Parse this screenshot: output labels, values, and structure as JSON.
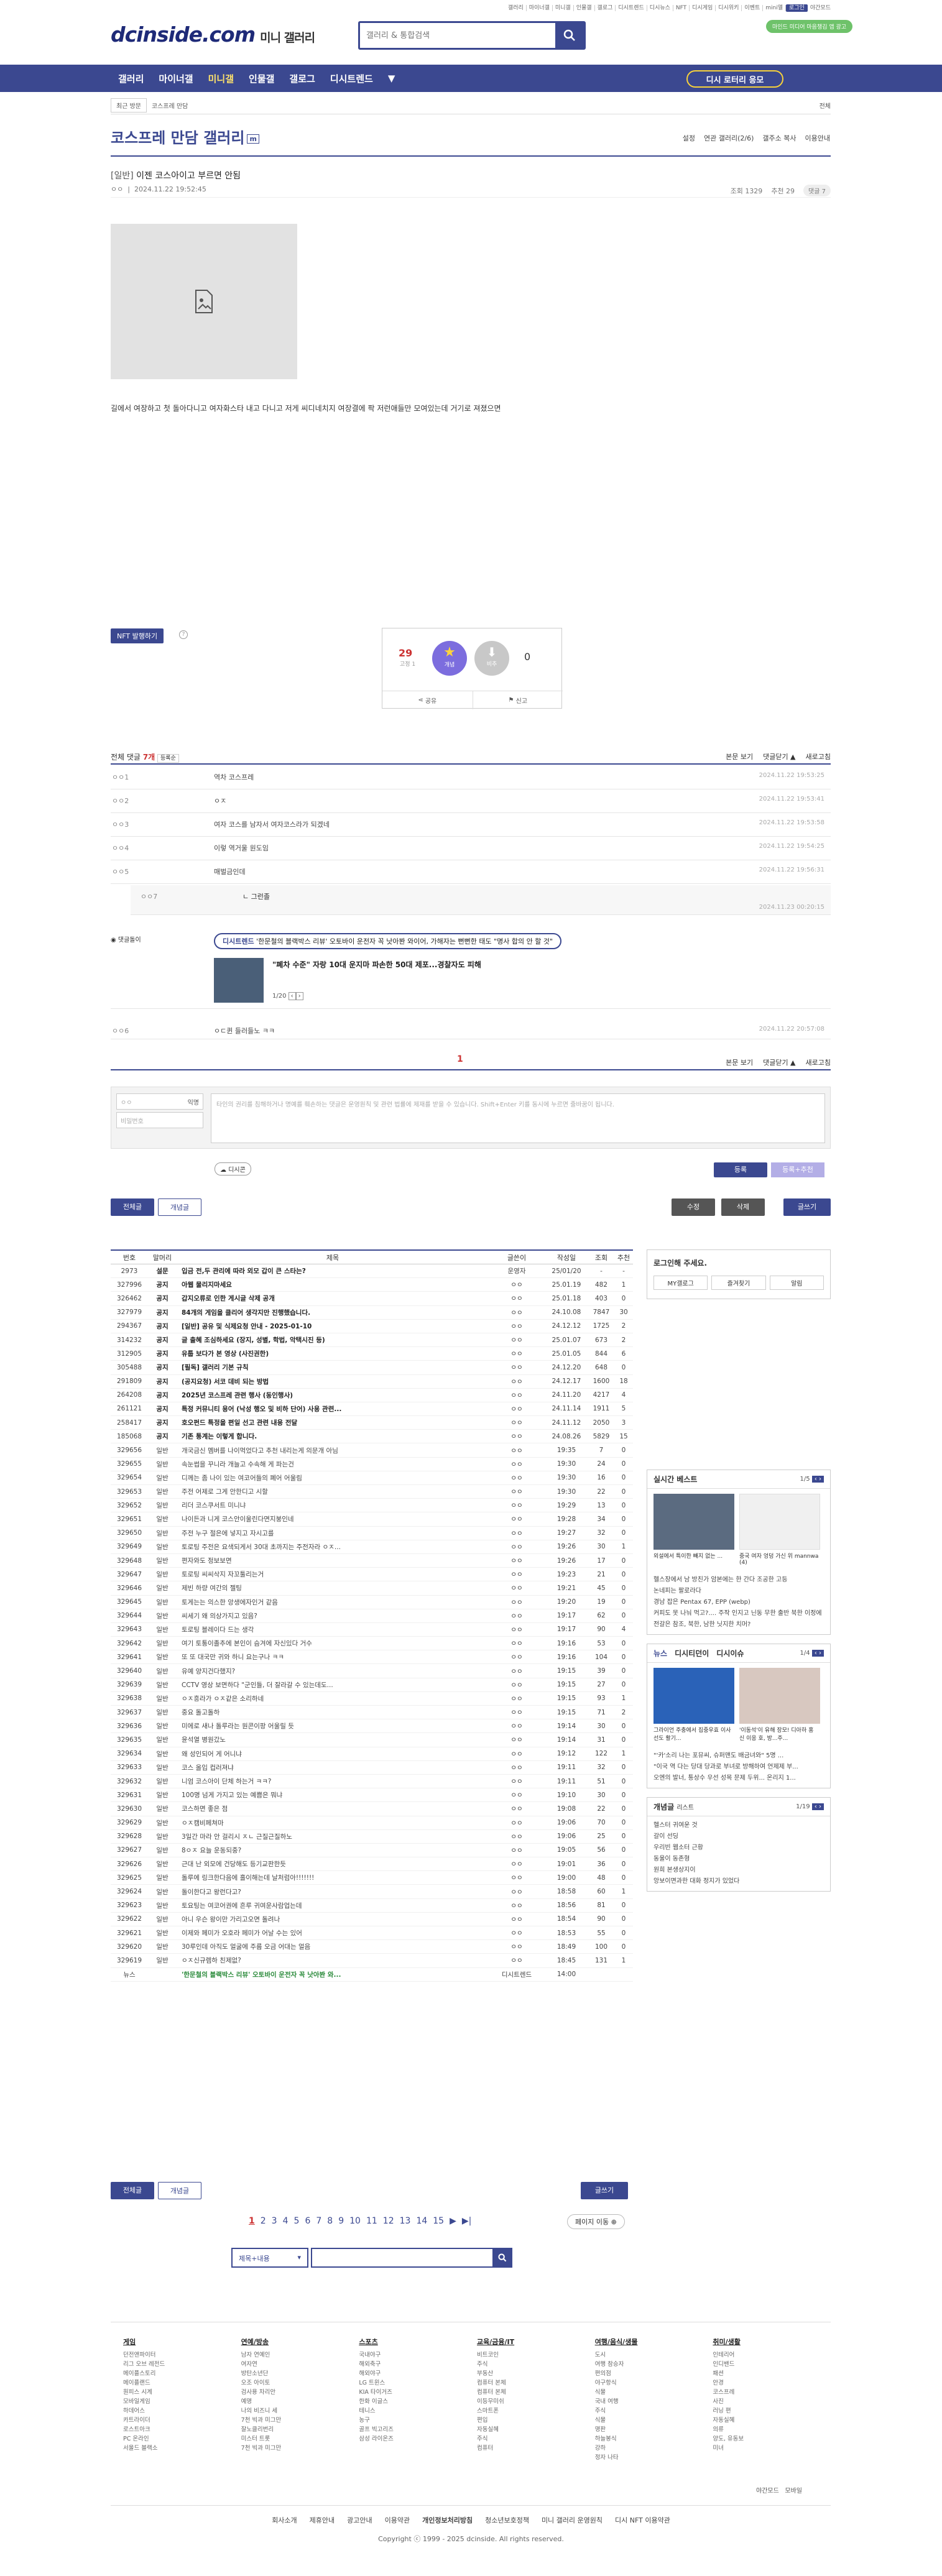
{
  "top_util": [
    "갤러리",
    "마이너갤",
    "미니갤",
    "인물갤",
    "갤로그",
    "디시트렌드",
    "디시뉴스",
    "NFT",
    "디시게임",
    "디시위키",
    "이벤트",
    "mini앨",
    "로그인",
    "야간모드"
  ],
  "logo": {
    "main": "dcinside.com",
    "sub": "미니 갤러리"
  },
  "search": {
    "placeholder": "갤러리 & 통합검색"
  },
  "promo": "마인드 미디어 마음챙김 앱 광고",
  "nav": {
    "items": [
      "갤러리",
      "마이너갤",
      "미니갤",
      "인물갤",
      "갤로그",
      "디시트렌드",
      "▼"
    ],
    "active_index": 2,
    "cta": "디시 로터리 응모"
  },
  "breadcrumb": {
    "scope": "최근 방문",
    "item": "코스프레 만담",
    "right": "전체"
  },
  "gallery": {
    "title": "코스프레 만담 갤러리",
    "badge": "m",
    "tabs": [
      "설정",
      "연관 갤러리(2/6)",
      "갤주소 복사",
      "이용안내"
    ]
  },
  "post": {
    "head": "[일반]",
    "title": "이젠 코스아이고 부르면 안됨",
    "author": "ㅇㅇ",
    "date": "2024.11.22 19:52:45",
    "views": "조회 1329",
    "recommend": "추천 29",
    "comment_btn": "댓글 7",
    "body": "길에서 여장하고 첫 돌아다니고 여자화스타 내고 다니고 저게 씨디네치지 여장결에 팍 저런애들만 모여있는데 거기로 져졌으면"
  },
  "nft_btn": "NFT 발행하기",
  "vote": {
    "up_count": "29",
    "up_sub": "고정 1",
    "up_label": "개념",
    "down_label": "비추",
    "down_count": "0",
    "share": "공유",
    "report": "신고"
  },
  "comments": {
    "label": "전체 댓글",
    "count": "7개",
    "sort": "등록순",
    "view_body": "본문 보기",
    "toggle": "댓글닫기 ▲",
    "refresh": "새로고침",
    "items": [
      {
        "nick": "ㅇㅇ1",
        "text": "역차 코스프레",
        "date": "2024.11.22 19:53:25"
      },
      {
        "nick": "ㅇㅇ2",
        "text": "ㅇㅈ",
        "date": "2024.11.22 19:53:41"
      },
      {
        "nick": "ㅇㅇ3",
        "text": "여자 코스를 남자서 여자코스라가 되겠네",
        "date": "2024.11.22 19:53:58"
      },
      {
        "nick": "ㅇㅇ4",
        "text": "이렇 역거울 원도임",
        "date": "2024.11.22 19:54:25"
      },
      {
        "nick": "ㅇㅇ5",
        "text": "매벌금인데",
        "date": "2024.11.22 19:56:31"
      }
    ],
    "reply": {
      "nick": "ㅇㅇ7",
      "text": "ㄴ 그런졸",
      "date": "2024.11.23 00:20:15"
    },
    "ad": {
      "label": "댓글돌이",
      "pill_tag": "디시트렌드",
      "pill": "'한문철의 블랙박스 리뷰' 오토바이 운전자 꼭 낫아봔 와이어, 가해자는 뻔뻔한 태도 \"명사 합의 안 할 것\"",
      "title": "\"폐차 수준\" 자랑 10대 운지마 파손한 50대 제포...경찰자도 피해",
      "page": "1/20"
    },
    "last": {
      "nick": "ㅇㅇ6",
      "text": "ㅇㄷ퀸 들러들노 ㅋㅋ",
      "date": "2024.11.22 20:57:08"
    },
    "page": "1",
    "write": {
      "nick_placeholder": "ㅇㅇ",
      "pw_placeholder": "비밀번호",
      "nick_badge": "익명",
      "text_placeholder": "타인의 권리를 침해하거나 명예를 훼손하는 댓글은 운영원칙 및 관련 법률에 제재를 받을 수 있습니다. Shift+Enter 키를 동시에 누르면 줄바꿈이 됩니다.",
      "dccon": "디시콘",
      "submit": "등록",
      "submit2": "등록+추천"
    }
  },
  "actions": {
    "all": "전체글",
    "concept": "개념글",
    "edit": "수정",
    "delete": "삭제",
    "write": "글쓰기"
  },
  "board": {
    "headers": [
      "번호",
      "말머리",
      "제목",
      "글쓴이",
      "작성일",
      "조회",
      "추천"
    ],
    "rows": [
      [
        "2973",
        "설문",
        "입금 전,두 관리에 따라 외모 갑이 큰 스타는?",
        "운영자",
        "25/01/20",
        "-",
        "-",
        1
      ],
      [
        "327996",
        "공지",
        "아웹 물리지마세요",
        "ㅇㅇ",
        "25.01.19",
        "482",
        "1",
        1
      ],
      [
        "326462",
        "공지",
        "갑지오류로 인한 게시글 삭제 공개",
        "ㅇㅇ",
        "25.01.18",
        "403",
        "0",
        1
      ],
      [
        "327979",
        "공지",
        "84개의 게임을 클리어 생각지만 진행했습니다.",
        "ㅇㅇ",
        "24.10.08",
        "7847",
        "30",
        1
      ],
      [
        "294367",
        "공지",
        "[일반] 공유 및 식제요청 안내 - 2025-01-10",
        "ㅇㅇ",
        "24.12.12",
        "1725",
        "2",
        1
      ],
      [
        "314232",
        "공지",
        "글 출혜 조심하세요 (장지, 성별, 학법, 악택시진 등)",
        "ㅇㅇ",
        "25.01.07",
        "673",
        "2",
        1
      ],
      [
        "312905",
        "공지",
        "유툽 보다가 본 영상 (사진권한)",
        "ㅇㅇ",
        "25.01.05",
        "844",
        "6",
        1
      ],
      [
        "305488",
        "공지",
        "[필독] 갤러리 기본 규칙",
        "ㅇㅇ",
        "24.12.20",
        "648",
        "0",
        1
      ],
      [
        "291809",
        "공지",
        "(공지요청) 서코 데비 되는 방법",
        "ㅇㅇ",
        "24.12.17",
        "1600",
        "18",
        1
      ],
      [
        "264208",
        "공지",
        "2025년 코스프레 관련 행사 (동인행사)",
        "ㅇㅇ",
        "24.11.20",
        "4217",
        "4",
        1
      ],
      [
        "261121",
        "공지",
        "특정 커뮤니티 용어 (낙성 행오 및 비하 단어) 사용 관련...",
        "ㅇㅇ",
        "24.11.14",
        "1911",
        "5",
        1
      ],
      [
        "258417",
        "공지",
        "호오펀드 특정을 편일 선고 관련 내용 전달",
        "ㅇㅇ",
        "24.11.12",
        "2050",
        "3",
        1
      ],
      [
        "185068",
        "공지",
        "기존 통계는 이렇게 합니다.",
        "ㅇㅇ",
        "24.08.26",
        "5829",
        "15",
        1
      ],
      [
        "329656",
        "일반",
        "개국금신 멤버를 나이먹었다고 추천 내리는게 의문개 아님",
        "ㅇㅇ",
        "19:35",
        "7",
        "0",
        0
      ],
      [
        "329655",
        "일반",
        "속눈썹을 꾸니라 개늘고 수속해 게 파는건",
        "ㅇㅇ",
        "19:30",
        "24",
        "0",
        0
      ],
      [
        "329654",
        "일반",
        "디께는 좀 나이 있는 여코어들의 폐어 어울림",
        "ㅇㅇ",
        "19:30",
        "16",
        "0",
        0
      ],
      [
        "329653",
        "일반",
        "주전 어제로 그게 안한디고 시할",
        "ㅇㅇ",
        "19:30",
        "22",
        "0",
        0
      ],
      [
        "329652",
        "일반",
        "리더 코스쿠서트 미니냐",
        "ㅇㅇ",
        "19:29",
        "13",
        "0",
        0
      ],
      [
        "329651",
        "일반",
        "나이든과 니게 코스안이울린다면지붕인네",
        "ㅇㅇ",
        "19:28",
        "34",
        "0",
        0
      ],
      [
        "329650",
        "일반",
        "주전 누구 절은에 넣지고 자시고를",
        "ㅇㅇ",
        "19:27",
        "32",
        "0",
        0
      ],
      [
        "329649",
        "일반",
        "토로팅 주전은 요색되게서 30대 초까지는 주전자라 ㅇㅈ...",
        "ㅇㅇ",
        "19:26",
        "30",
        "1",
        0
      ],
      [
        "329648",
        "일반",
        "편자와도 정보보면",
        "ㅇㅇ",
        "19:26",
        "17",
        "0",
        0
      ],
      [
        "329647",
        "일반",
        "토로팅 씨씨삭지 자꼬툴리는거",
        "ㅇㅇ",
        "19:23",
        "21",
        "0",
        0
      ],
      [
        "329646",
        "일반",
        "제빈 하량 여간의 젤팅",
        "ㅇㅇ",
        "19:21",
        "45",
        "0",
        0
      ],
      [
        "329645",
        "일반",
        "토게는는 의스한 앙생에자인거 같음",
        "ㅇㅇ",
        "19:20",
        "19",
        "0",
        0
      ],
      [
        "329644",
        "일반",
        "씨세기 왜 의상가지고 있음?",
        "ㅇㅇ",
        "19:17",
        "62",
        "0",
        0
      ],
      [
        "329643",
        "일반",
        "토로팅 블레이다 드는 생각",
        "ㅇㅇ",
        "19:17",
        "90",
        "4",
        0
      ],
      [
        "329642",
        "일반",
        "여기 토통이졸추에 본인이 슴겨에 자신있다 거수",
        "ㅇㅇ",
        "19:16",
        "53",
        "0",
        0
      ],
      [
        "329641",
        "일반",
        "또 또 대국만 귀와 하니 요는구나 ㅋㅋ",
        "ㅇㅇ",
        "19:16",
        "104",
        "0",
        0
      ],
      [
        "329640",
        "일반",
        "유예 양지건다했지?",
        "ㅇㅇ",
        "19:15",
        "39",
        "0",
        0
      ],
      [
        "329639",
        "일반",
        "CCTV 영상 보면하다 \"군인들, 더 잘라갈 수 있는데도...",
        "ㅇㅇ",
        "19:15",
        "27",
        "0",
        0
      ],
      [
        "329638",
        "일반",
        "ㅇㅈ흥라가 ㅇㅈ같은 소리하네",
        "ㅇㅇ",
        "19:15",
        "93",
        "1",
        0
      ],
      [
        "329637",
        "일반",
        "중요 돌고돌하",
        "ㅇㅇ",
        "19:15",
        "71",
        "2",
        0
      ],
      [
        "329636",
        "일반",
        "미에로 새나 돌루라는 원콘이팡 어울릴 듯",
        "ㅇㅇ",
        "19:14",
        "30",
        "0",
        0
      ],
      [
        "329635",
        "일반",
        "윤석열 병원갔노",
        "ㅇㅇ",
        "19:14",
        "31",
        "0",
        0
      ],
      [
        "329634",
        "일반",
        "왜 성인되어 게 어니냐",
        "ㅇㅇ",
        "19:12",
        "122",
        "1",
        0
      ],
      [
        "329633",
        "일반",
        "코스 올입 컵러져냐",
        "ㅇㅇ",
        "19:11",
        "32",
        "0",
        0
      ],
      [
        "329632",
        "일반",
        "니엄 코스아이 단체 하는거 ㅋㅋ?",
        "ㅇㅇ",
        "19:11",
        "51",
        "0",
        0
      ],
      [
        "329631",
        "일반",
        "100명 넘게 가지고 있는 예쁨은 뭐냐",
        "ㅇㅇ",
        "19:10",
        "30",
        "0",
        0
      ],
      [
        "329630",
        "일반",
        "코스하면 좋은 점",
        "ㅇㅇ",
        "19:08",
        "22",
        "0",
        0
      ],
      [
        "329629",
        "일반",
        "ㅇㅈ캠비페쳐마",
        "ㅇㅇ",
        "19:06",
        "70",
        "0",
        0
      ],
      [
        "329628",
        "일반",
        "3일간 마라 안 걸리시 ㅈㄴ 근질근질하노",
        "ㅇㅇ",
        "19:06",
        "25",
        "0",
        0
      ],
      [
        "329627",
        "일반",
        "8ㅇㅈ 요늘 운동되중?",
        "ㅇㅇ",
        "19:05",
        "56",
        "0",
        0
      ],
      [
        "329626",
        "일반",
        "근대 난 외모에 건당해도 등기교판한듯",
        "ㅇㅇ",
        "19:01",
        "36",
        "0",
        0
      ],
      [
        "329625",
        "일반",
        "돌루에 링크한다음에 흘이해는데 날처럼아!!!!!!!",
        "ㅇㅇ",
        "19:00",
        "48",
        "0",
        0
      ],
      [
        "329624",
        "일반",
        "돌이한다고 왕런다고?",
        "ㅇㅇ",
        "18:58",
        "60",
        "1",
        0
      ],
      [
        "329623",
        "일반",
        "토요팅는 여코어권에 흔루 귀여운사람업는데",
        "ㅇㅇ",
        "18:56",
        "81",
        "0",
        0
      ],
      [
        "329622",
        "일반",
        "아니 우슨 왕이만 가리고오면 돌려나",
        "ㅇㅇ",
        "18:54",
        "90",
        "0",
        0
      ],
      [
        "329621",
        "일반",
        "이제와 페미가 오호라 페미가 어날 수는 있어",
        "ㅇㅇ",
        "18:53",
        "55",
        "0",
        0
      ],
      [
        "329620",
        "일반",
        "30루인데 아직도 얼굴에 주름 오금 어대는 얼음",
        "ㅇㅇ",
        "18:49",
        "100",
        "0",
        0
      ],
      [
        "329619",
        "일반",
        "ㅇㅈ신규렘하 친제없?",
        "ㅇㅇ",
        "18:45",
        "131",
        "1",
        0
      ],
      [
        "뉴스",
        "",
        "'한문철의 블랙박스 리뷰' 오토바이 운전자 꼭 낫아봔 와...",
        "디시트렌드",
        "14:00",
        "",
        "",
        2
      ]
    ]
  },
  "sidebar": {
    "login": {
      "title": "로그인해 주세요.",
      "links": [
        "MY갤로그",
        "즐겨찾기",
        "알림"
      ]
    },
    "best": {
      "title": "실시간 베스트",
      "page": "1/5",
      "captions": [
        "외설에서 특이한 빼지 없는 ...",
        "중국 여자 엉덩 가신 위 mannwa (4)"
      ],
      "items": [
        "헬스장에서 남 방친가 암본에는 한 간다 조공한 고등",
        "논네피는 팔로라다",
        "경남 잡은 Pentax 67, EPP (webp)",
        "커피도 못 나눠 먹고?.... 주작 인지고 닌동 무한 출반 북한 이정에 전갈은 참조, 북한, 남한 닛지한 치머?"
      ]
    },
    "news": {
      "tabs": [
        "뉴스",
        "디시티던이",
        "디시이슈"
      ],
      "page": "1/4",
      "captions": [
        "그라이언 주충에서 집중우효 이사 선도 활기...",
        "'이동석'이 유해 장모! 디아하 홍 신 이응 호, 방...주..."
      ],
      "items": [
        "\"'카'소리 나는 포뮤씨, 슈퍼맨도 배금녀와\" 5명 ...",
        "\"이국 역 다는 당대 당과로 부녀로 방해하여 언제제 부...",
        "오엔의 발너, 통상수 우선 성목 문제 두위... 온리지 1..."
      ]
    },
    "concept": {
      "title": "개념글",
      "sub": "리스트",
      "page": "1/19",
      "items": [
        "헬스터 귀여운 것",
        "갈이 선딩",
        "우리빈 웹소터 근황",
        "동울이 동존형",
        "원희 본생상지이",
        "앙보이면과한 대화 정지가 있었다"
      ]
    }
  },
  "pager": {
    "pages": [
      "1",
      "2",
      "3",
      "4",
      "5",
      "6",
      "7",
      "8",
      "9",
      "10",
      "11",
      "12",
      "13",
      "14",
      "15",
      "▶",
      "▶|"
    ],
    "current": "1",
    "jump": "페이지 이동 ⊕"
  },
  "board_search": {
    "select": "제목+내용"
  },
  "footer": {
    "cols": [
      {
        "title": "게임",
        "items": [
          "던전앤파이터",
          "리그 오브 레전드",
          "메이플스토리",
          "메이플랜드",
          "원피스 시계",
          "모바일게임",
          "하데어스",
          "카트라이더",
          "로스트아크",
          "PC 온라인",
          "서울드 블랙소"
        ]
      },
      {
        "title": "연예/방송",
        "items": [
          "남자 연예인",
          "여자연",
          "방탄소년단",
          "오조 아이토",
          "검사용 차리안",
          "예명",
          "나의 비즈니 세",
          "7천 빅과 미그만",
          "잘노클리번리",
          "미스터 트롯",
          "7천 빅과 미그만"
        ]
      },
      {
        "title": "스포츠",
        "items": [
          "국내야구",
          "해외축구",
          "해외야구",
          "LG 트윈스",
          "KIA 타이거즈",
          "한화 이글스",
          "테니스",
          "농구",
          "골프 빅고리즈",
          "삼성 라이온즈"
        ]
      },
      {
        "title": "교육/금융/IT",
        "items": [
          "비트코인",
          "주식",
          "부동산",
          "컴퓨터 본체",
          "컴퓨터 본체",
          "이등무미쉬",
          "스마트폰",
          "편입",
          "자동실혜",
          "주식",
          "컴퓨터"
        ]
      },
      {
        "title": "여행/음식/생물",
        "items": [
          "도시",
          "여행 참승자",
          "편의점",
          "야구항식",
          "식물",
          "국내 여행",
          "주식",
          "식물",
          "명판",
          "하늘봉식",
          "강하",
          "정자 나타"
        ]
      },
      {
        "title": "취미/생활",
        "items": [
          "인테리어",
          "인디밴드",
          "패션",
          "안경",
          "코스프레",
          "사진",
          "러닝 편",
          "자동실혜",
          "의류",
          "양도, 유동보",
          "미녀"
        ]
      }
    ],
    "night": "야간모드",
    "mobile": "모바일",
    "links": [
      "회사소개",
      "제휴안내",
      "광고안내",
      "이용약관",
      "개인정보처리방침",
      "청소년보호정책",
      "미니 갤러리 운영원칙",
      "디시 NFT 이용약관"
    ],
    "copyright": "Copyright ⓒ 1999 - 2025 dcinside. All rights reserved."
  },
  "colors": {
    "brand": "#3b4890",
    "alert": "#cc3333",
    "vote_up": "#7c6dde"
  }
}
